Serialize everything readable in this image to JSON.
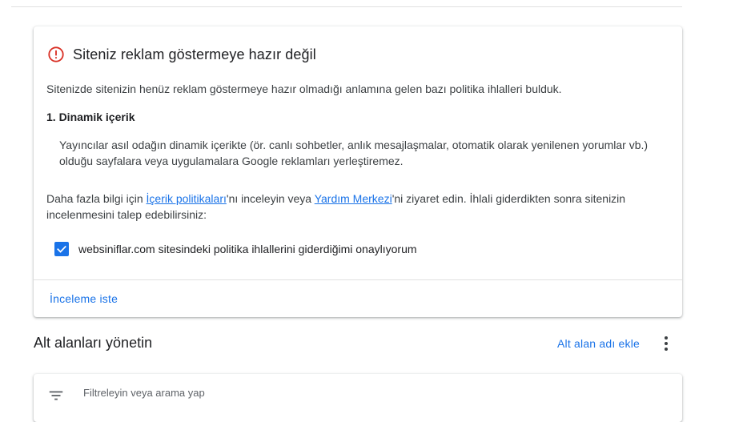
{
  "card": {
    "title": "Siteniz reklam göstermeye hazır değil",
    "intro": "Sitenizde sitenizin henüz reklam göstermeye hazır olmadığı anlamına gelen bazı politika ihlalleri bulduk.",
    "section_title": "1. Dinamik içerik",
    "section_body": "Yayıncılar asıl odağın dinamik içerikte (ör. canlı sohbetler, anlık mesajlaşmalar, otomatik olarak yenilenen yorumlar vb.) olduğu sayfalara veya uygulamalara Google reklamları yerleştiremez.",
    "info_prefix": "Daha fazla bilgi için ",
    "policy_link": "İçerik politikaları",
    "info_mid": "'nı inceleyin veya ",
    "help_link": "Yardım Merkezi",
    "info_suffix": "'ni ziyaret edin. İhlali giderdikten sonra sitenizin incelenmesini talep edebilirsiniz:",
    "confirm_label": "websiniflar.com sitesindeki politika ihlallerini giderdiğimi onaylıyorum",
    "confirm_checked": true,
    "review_button": "İnceleme iste"
  },
  "subdomains": {
    "title": "Alt alanları yönetin",
    "add_button": "Alt alan adı ekle",
    "filter_placeholder": "Filtreleyin veya arama yap"
  },
  "colors": {
    "alert": "#d93025",
    "accent": "#1a73e8"
  }
}
